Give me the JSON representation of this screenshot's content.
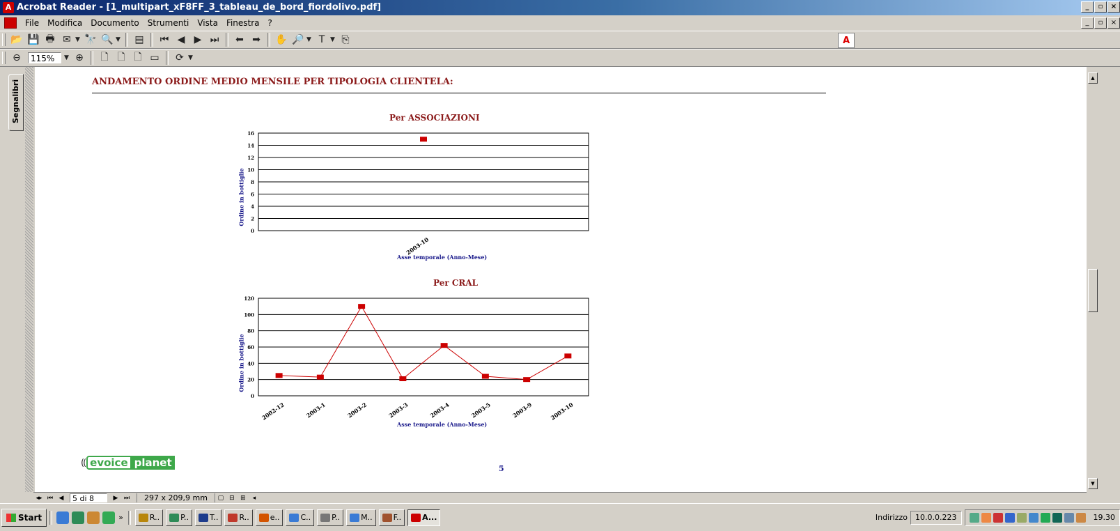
{
  "window": {
    "title": "Acrobat Reader - [1_multipart_xF8FF_3_tableau_de_bord_fiordolivo.pdf]"
  },
  "menu": [
    "File",
    "Modifica",
    "Documento",
    "Strumenti",
    "Vista",
    "Finestra",
    "?"
  ],
  "toolbar": {
    "zoom_value": "115%",
    "adobe_logo": "Adobe"
  },
  "side_panel": {
    "bookmarks_tab": "Segnalibri"
  },
  "document": {
    "heading": "ANDAMENTO ORDINE MEDIO MENSILE PER TIPOLOGIA CLIENTELA:",
    "page_number": "5",
    "logo": {
      "left": "((",
      "voice": "evoice",
      "planet": "planet"
    }
  },
  "chart_data": [
    {
      "type": "line",
      "title": "Per ASSOCIAZIONI",
      "xlabel": "Asse temporale (Anno-Mese)",
      "ylabel": "Ordine in bottiglie",
      "categories": [
        "2003-10"
      ],
      "series": [
        {
          "values": [
            15
          ]
        }
      ],
      "ylim": [
        0,
        16
      ],
      "yticks": [
        0,
        2,
        4,
        6,
        8,
        10,
        12,
        14,
        16
      ],
      "grid": true,
      "color": "#cc0000"
    },
    {
      "type": "line",
      "title": "Per CRAL",
      "xlabel": "Asse temporale (Anno-Mese)",
      "ylabel": "Ordine in bottiglie",
      "categories": [
        "2002-12",
        "2003-1",
        "2003-2",
        "2003-3",
        "2003-4",
        "2003-5",
        "2003-9",
        "2003-10"
      ],
      "series": [
        {
          "values": [
            25,
            23,
            110,
            21,
            62,
            24,
            20,
            49
          ]
        }
      ],
      "ylim": [
        0,
        120
      ],
      "yticks": [
        0,
        20,
        40,
        60,
        80,
        100,
        120
      ],
      "grid": true,
      "color": "#cc0000"
    }
  ],
  "status_bar": {
    "page_indicator": "5 di 8",
    "page_size": "297 x 209,9 mm"
  },
  "taskbar": {
    "start_label": "Start",
    "tasks": [
      "R..",
      "P..",
      "T..",
      "R..",
      "e..",
      "C..",
      "P..",
      "M..",
      "F..",
      "A..."
    ],
    "address_label": "Indirizzo",
    "address_value": "10.0.0.223",
    "clock": "19.30"
  }
}
